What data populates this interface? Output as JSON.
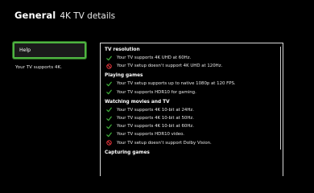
{
  "header": {
    "title": "General",
    "subtitle": "4K TV details"
  },
  "left": {
    "help_label": "Help",
    "support_text": "Your TV supports 4K."
  },
  "sections": [
    {
      "title": "TV resolution",
      "items": [
        {
          "status": "ok",
          "text": "Your TV supports 4K UHD at 60Hz."
        },
        {
          "status": "no",
          "text": "Your TV setup doesn't support 4K UHD at 120Hz."
        }
      ]
    },
    {
      "title": "Playing games",
      "items": [
        {
          "status": "ok",
          "text": "Your TV setup supports up to native 1080p at 120 FPS."
        },
        {
          "status": "ok",
          "text": "Your TV supports HDR10 for gaming."
        }
      ]
    },
    {
      "title": "Watching movies and TV",
      "items": [
        {
          "status": "ok",
          "text": "Your TV supports 4K 10-bit at 24Hz."
        },
        {
          "status": "ok",
          "text": "Your TV supports 4K 10-bit at 50Hz."
        },
        {
          "status": "ok",
          "text": "Your TV supports 4K 10-bit at 60Hz."
        },
        {
          "status": "ok",
          "text": "Your TV supports HDR10 video."
        },
        {
          "status": "no",
          "text": "Your TV setup doesn't support Dolby Vision."
        }
      ]
    },
    {
      "title": "Capturing games",
      "items": []
    }
  ],
  "colors": {
    "ok": "#3fb23a",
    "no": "#e0343a",
    "focus": "#4fb441"
  },
  "icons": {
    "ok": "check-icon",
    "no": "prohibited-icon"
  }
}
